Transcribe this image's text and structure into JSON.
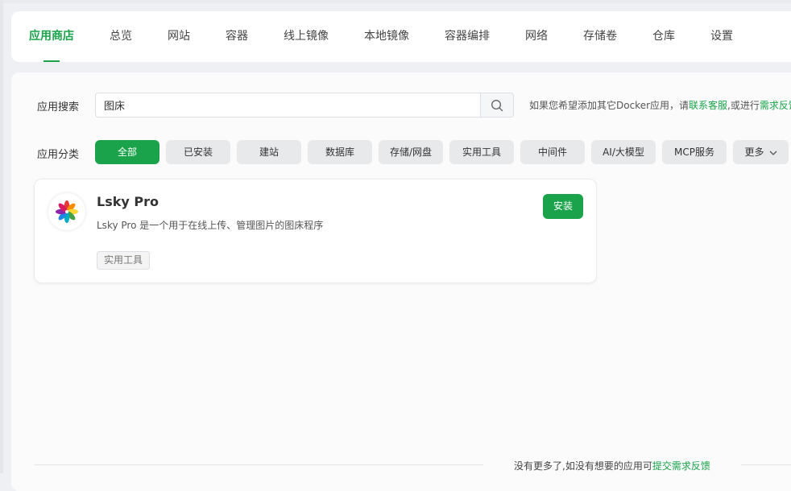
{
  "nav": {
    "items": [
      {
        "label": "应用商店",
        "active": true
      },
      {
        "label": "总览"
      },
      {
        "label": "网站"
      },
      {
        "label": "容器"
      },
      {
        "label": "线上镜像"
      },
      {
        "label": "本地镜像"
      },
      {
        "label": "容器编排"
      },
      {
        "label": "网络"
      },
      {
        "label": "存储卷"
      },
      {
        "label": "仓库"
      },
      {
        "label": "设置"
      }
    ]
  },
  "search": {
    "label": "应用搜索",
    "value": "图床",
    "hint_prefix": "如果您希望添加其它Docker应用，请",
    "hint_link1": "联系客服",
    "hint_mid": ",或进行",
    "hint_link2": "需求反馈"
  },
  "category": {
    "label": "应用分类",
    "chips": [
      "全部",
      "已安装",
      "建站",
      "数据库",
      "存储/网盘",
      "实用工具",
      "中间件",
      "AI/大模型",
      "MCP服务",
      "更多"
    ],
    "active_index": 0
  },
  "app": {
    "name": "Lsky Pro",
    "description": "Lsky Pro 是一个用于在线上传、管理图片的图床程序",
    "tag": "实用工具",
    "install_label": "安装"
  },
  "footer": {
    "text": "没有更多了,如没有想要的应用可",
    "link": "提交需求反馈"
  },
  "colors": {
    "accent": "#1aa34a",
    "chip_bg": "#e8e9eb"
  }
}
